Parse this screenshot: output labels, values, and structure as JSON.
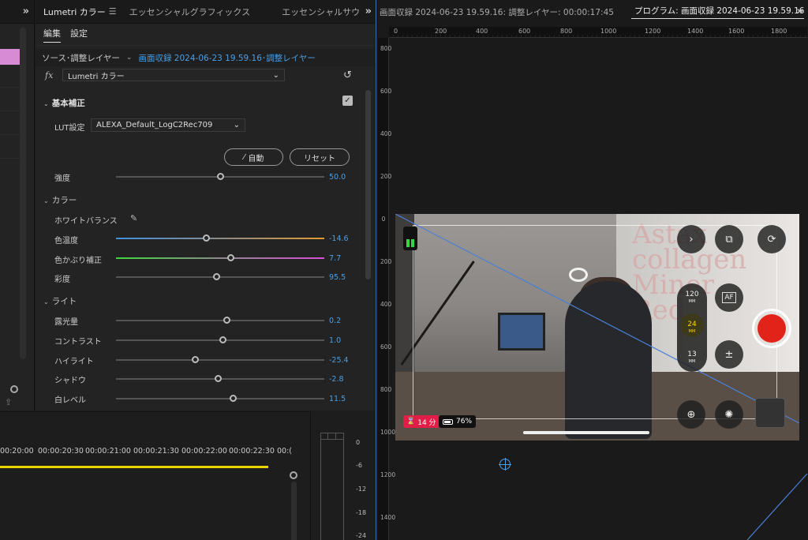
{
  "effect_panel": {
    "tabs": [
      "Lumetri カラー",
      "エッセンシャルグラフィックス",
      "エッセンシャルサウ"
    ],
    "subtabs": [
      "編集",
      "設定"
    ],
    "source_label": "ソース･調整レイヤー",
    "source_link": "画面収録 2024-06-23 19.59.16･調整レイヤー",
    "fx_label": "fx",
    "effect_name": "Lumetri カラー",
    "section_basic": "基本補正",
    "lut_label": "LUT設定",
    "lut_value": "ALEXA_Default_LogC2Rec709",
    "auto_button": "自動",
    "reset_button": "リセット",
    "intensity": {
      "label": "強度",
      "value": "50.0",
      "pos": 0.5
    },
    "section_color": "カラー",
    "white_balance": "ホワイトバランス",
    "temperature": {
      "label": "色温度",
      "value": "-14.6",
      "pos": 0.43
    },
    "tint": {
      "label": "色かぶり補正",
      "value": "7.7",
      "pos": 0.55
    },
    "saturation": {
      "label": "彩度",
      "value": "95.5",
      "pos": 0.48
    },
    "section_light": "ライト",
    "light_params": [
      {
        "label": "露光量",
        "value": "0.2",
        "pos": 0.53
      },
      {
        "label": "コントラスト",
        "value": "1.0",
        "pos": 0.51
      },
      {
        "label": "ハイライト",
        "value": "-25.4",
        "pos": 0.38
      },
      {
        "label": "シャドウ",
        "value": "-2.8",
        "pos": 0.49
      },
      {
        "label": "白レベル",
        "value": "11.5",
        "pos": 0.56
      }
    ]
  },
  "timeline": {
    "timecodes": [
      "00:20:00",
      "00:00:20:30",
      "00:00:21:00",
      "00:00:21:30",
      "00:00:22:00",
      "00:00:22:30",
      "00:("
    ]
  },
  "audio_meter": {
    "scale": [
      "0",
      "-6",
      "-12",
      "-18",
      "-24"
    ]
  },
  "program": {
    "source_tab": "画面収録 2024-06-23 19.59.16: 調整レイヤー: 00:00:17:45",
    "program_tab": "プログラム: 画面収録 2024-06-23 19.59.16",
    "h_ruler": [
      "0",
      "200",
      "400",
      "600",
      "800",
      "1000",
      "1200",
      "1400",
      "1600",
      "1800"
    ],
    "v_ruler": [
      "800",
      "600",
      "400",
      "200",
      "0",
      "200",
      "400",
      "600",
      "800",
      "1000",
      "1200",
      "1400"
    ],
    "overlay": {
      "rec_time": "14 分",
      "battery": "76%",
      "zoom_levels": [
        {
          "value": "120",
          "unit": "MM"
        },
        {
          "value": "24",
          "unit": "MM"
        },
        {
          "value": "13",
          "unit": "MM"
        }
      ],
      "af_label": "AF",
      "wall_text": "Astax\ncollagen\nMiner\nRed"
    }
  },
  "colors": {
    "accent_blue": "#4a9fe6",
    "record_red": "#e2231a",
    "clip_pink": "#d78bd5",
    "timeline_yellow": "#e8d400"
  }
}
